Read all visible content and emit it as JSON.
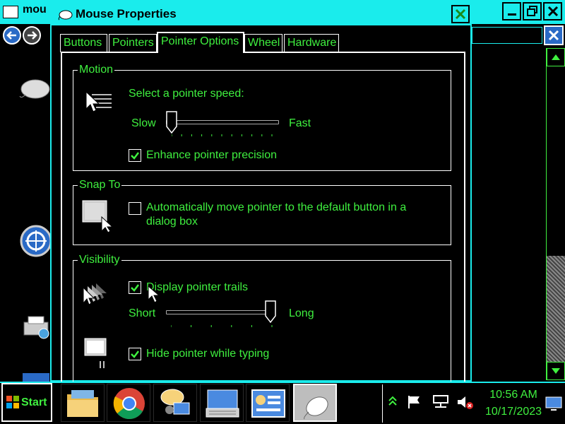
{
  "background_window": {
    "title_fragment": "mou"
  },
  "dialog": {
    "title": "Mouse Properties",
    "tabs": [
      {
        "label": "Buttons",
        "active": false
      },
      {
        "label": "Pointers",
        "active": false
      },
      {
        "label": "Pointer Options",
        "active": true
      },
      {
        "label": "Wheel",
        "active": false
      },
      {
        "label": "Hardware",
        "active": false
      }
    ],
    "motion": {
      "group_label": "Motion",
      "speed_prompt": "Select a pointer speed:",
      "slow_label": "Slow",
      "fast_label": "Fast",
      "speed_level": 0.0,
      "enhance_precision_label": "Enhance pointer precision",
      "enhance_precision_checked": true
    },
    "snap_to": {
      "group_label": "Snap To",
      "auto_move_label_line1": "Automatically move pointer to the default button in a",
      "auto_move_label_line2": "dialog box",
      "auto_move_checked": false
    },
    "visibility": {
      "group_label": "Visibility",
      "trails_label": "Display pointer trails",
      "trails_checked": true,
      "short_label": "Short",
      "long_label": "Long",
      "trail_length_level": 1.0,
      "hide_while_typing_label": "Hide pointer while typing",
      "hide_while_typing_checked": true
    }
  },
  "taskbar": {
    "start_label": "Start",
    "buttons": [
      {
        "name": "file-explorer",
        "icon": "folder-icon"
      },
      {
        "name": "chrome",
        "icon": "chrome-icon"
      },
      {
        "name": "messenger",
        "icon": "chat-people-icon"
      },
      {
        "name": "keyboard",
        "icon": "keyboard-icon"
      },
      {
        "name": "control-panel",
        "icon": "control-panel-icon"
      },
      {
        "name": "mouse",
        "icon": "mouse-icon",
        "active": true
      }
    ],
    "clock_time": "10:56 AM",
    "clock_date": "10/17/2023"
  },
  "colors": {
    "accent": "#1aecec",
    "text": "#3ff03f",
    "background": "#000000",
    "border": "#ffffff"
  }
}
